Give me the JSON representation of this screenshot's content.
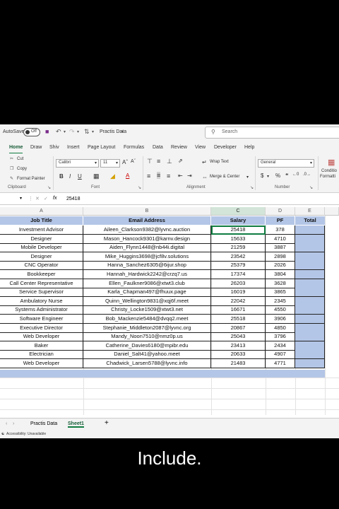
{
  "titlebar": {
    "autosave_label": "AutoSave",
    "toggle_state": "Off",
    "doc_name": "Practis Data",
    "search_placeholder": "Search"
  },
  "menu_tabs": [
    "Home",
    "Draw",
    "Shiv",
    "Insert",
    "Page Layout",
    "Formulas",
    "Data",
    "Review",
    "View",
    "Developer",
    "Help"
  ],
  "ribbon": {
    "cut": "Cut",
    "copy": "Copy",
    "format_painter": "Format Painter",
    "clipboard": "Clipboard",
    "font_name": "Calibri",
    "font_size": "11",
    "font_group": "Font",
    "wrap_text": "Wrap Text",
    "merge_center": "Merge & Center",
    "alignment_group": "Alignment",
    "number_format": "General",
    "number_group": "Number",
    "conditional": "Conditio",
    "conditional2": "Formatti"
  },
  "formula_bar": {
    "name_box": "",
    "value": "25418"
  },
  "columns": [
    "A",
    "B",
    "C",
    "D",
    "E"
  ],
  "headers": [
    "Job Title",
    "Email Address",
    "Salary",
    "PF",
    "Total"
  ],
  "rows": [
    [
      "Investment  Advisor",
      "Aileen_Clarkson9382@lyvnc.auction",
      "25418",
      "378",
      ""
    ],
    [
      "Designer",
      "Mason_Hancock9301@karnv.design",
      "15633",
      "4710",
      ""
    ],
    [
      "Mobile Developer",
      "Aiden_Flynn1448@nb44i.digital",
      "21259",
      "3887",
      ""
    ],
    [
      "Designer",
      "Mike_Huggins3698@jcf8v.solutions",
      "23542",
      "2898",
      ""
    ],
    [
      "CNC Operator",
      "Hanna_Sanchez6305@6ijur.shop",
      "25379",
      "2026",
      ""
    ],
    [
      "Bookkeeper",
      "Hannah_Hardwick2242@crzq7.us",
      "17374",
      "3804",
      ""
    ],
    [
      "Call Center Representative",
      "Ellen_Faulkner9086@xtwt3.club",
      "26203",
      "3628",
      ""
    ],
    [
      "Service Supervisor",
      "Karla_Chapman497@fhuux.page",
      "16019",
      "3865",
      ""
    ],
    [
      "Ambulatory Nurse",
      "Quinn_Wellington9831@xqj6f.meet",
      "22042",
      "2345",
      ""
    ],
    [
      "Systems Administrator",
      "Christy_Locke1509@xtwt3.net",
      "16671",
      "4550",
      ""
    ],
    [
      "Software Engineer",
      "Bob_Mackenzie5484@dvqq2.meet",
      "25518",
      "3906",
      ""
    ],
    [
      "Executive Director",
      "Stephanie_Middleton2087@lyvnc.org",
      "20867",
      "4850",
      ""
    ],
    [
      "Web Developer",
      "Mandy_Noon7510@nmz0p.us",
      "25043",
      "3796",
      ""
    ],
    [
      "Baker",
      "Catherine_Davies6180@mpibr.edu",
      "23413",
      "2434",
      ""
    ],
    [
      "Electrician",
      "Daniel_Salt41@yahoo.meet",
      "20633",
      "4907",
      ""
    ],
    [
      "Web Developer",
      "Chadwick_Larsen5788@lyvnc.info",
      "21483",
      "4771",
      ""
    ]
  ],
  "sheets": [
    "Practis Data",
    "Sheet1"
  ],
  "status": "Accessibility: Unavailable",
  "subtitle": "Include."
}
